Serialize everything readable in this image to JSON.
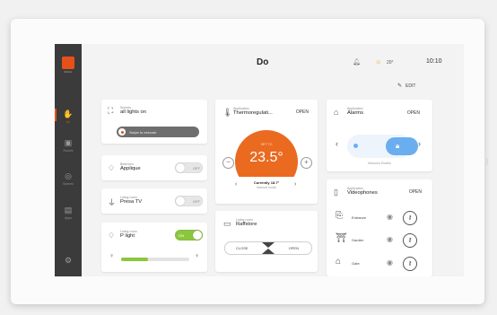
{
  "header": {
    "title": "Do",
    "weather": "20°",
    "time": "10:10",
    "edit_label": "EDIT"
  },
  "sidebar": {
    "logo_text": "bticino",
    "items": [
      {
        "label": "Do",
        "icon": "hand-icon",
        "active": true
      },
      {
        "label": "Rooms",
        "icon": "rooms-icon"
      },
      {
        "label": "Scenes",
        "icon": "scenes-icon"
      },
      {
        "label": "Apps",
        "icon": "apps-icon"
      },
      {
        "label": "",
        "icon": "settings-icon"
      }
    ]
  },
  "scenes_card": {
    "small": "Scenes",
    "title": "all lights on",
    "button": "Swipe to execute"
  },
  "applique_card": {
    "small": "Bedroom",
    "title": "Applique",
    "state": "OFF"
  },
  "presa_card": {
    "small": "Living room",
    "title": "Presa TV",
    "state": "OFF"
  },
  "plight_card": {
    "small": "Living room",
    "title": "P light",
    "state": "ON",
    "level": 0.4
  },
  "thermo_card": {
    "small": "Application",
    "title": "Thermoregulati...",
    "open": "OPEN",
    "set_label": "SET TO",
    "value": "23.5°",
    "current": "Currently 18.7°",
    "mode": "Manual mode"
  },
  "raff_card": {
    "small": "Living room",
    "title": "Raffstore",
    "close": "CLOSE",
    "open": "OPEN"
  },
  "alarms_card": {
    "small": "Application",
    "title": "Alarms",
    "open": "OPEN",
    "status": "Intrusion Enable"
  },
  "video_card": {
    "small": "Application",
    "title": "Videophones",
    "open": "OPEN",
    "rows": [
      {
        "name": "Entrance"
      },
      {
        "name": "Garden"
      },
      {
        "name": "Gate"
      }
    ]
  },
  "colors": {
    "accent": "#e8501a",
    "toggle_on": "#8cc63e",
    "alarm_blue": "#6aaef0"
  }
}
